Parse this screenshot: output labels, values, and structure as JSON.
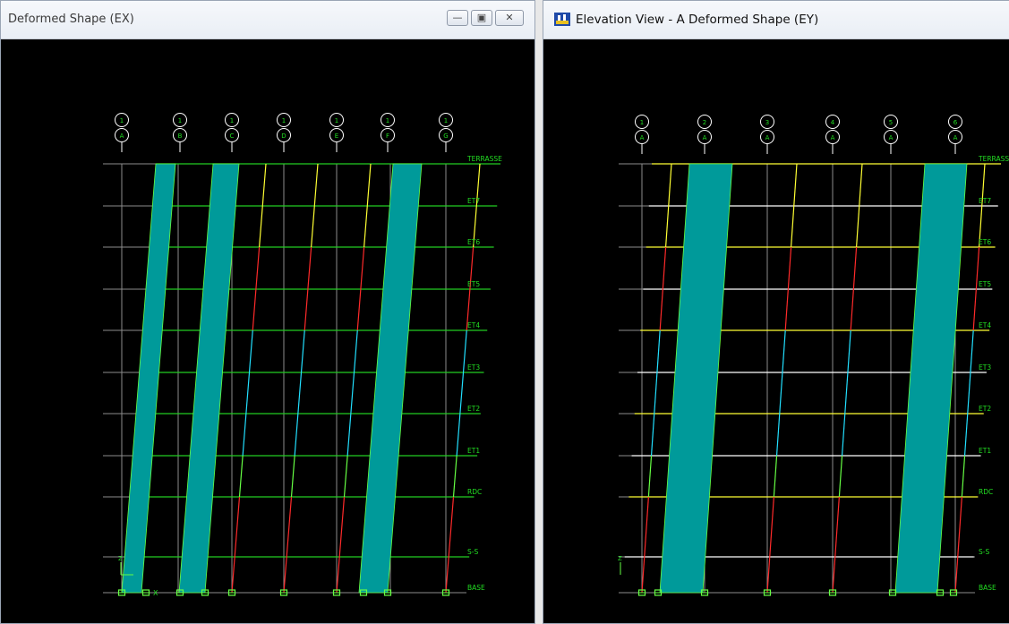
{
  "left_window": {
    "title": "Deformed Shape (EX)",
    "buttons": {
      "minimize": "—",
      "restore": "▣",
      "close": "✕"
    },
    "grid_bubbles": [
      {
        "top": "1",
        "bottom": "A"
      },
      {
        "top": "1",
        "bottom": "B"
      },
      {
        "top": "1",
        "bottom": "C"
      },
      {
        "top": "1",
        "bottom": "D"
      },
      {
        "top": "1",
        "bottom": "E"
      },
      {
        "top": "1",
        "bottom": "F"
      },
      {
        "top": "1",
        "bottom": "G"
      }
    ],
    "story_labels": [
      "TERRASSE",
      "ET7",
      "ET6",
      "ET5",
      "ET4",
      "ET3",
      "ET2",
      "ET1",
      "RDC",
      "S-S",
      "BASE"
    ],
    "axis_labels": {
      "z": "Z",
      "x": "X"
    }
  },
  "right_window": {
    "title": "Elevation View - A  Deformed Shape (EY)",
    "grid_bubbles": [
      {
        "top": "1",
        "bottom": "A"
      },
      {
        "top": "2",
        "bottom": "A"
      },
      {
        "top": "3",
        "bottom": "A"
      },
      {
        "top": "4",
        "bottom": "A"
      },
      {
        "top": "5",
        "bottom": "A"
      },
      {
        "top": "6",
        "bottom": "A"
      }
    ],
    "story_labels": [
      "TERRASSE",
      "ET7",
      "ET6",
      "ET5",
      "ET4",
      "ET3",
      "ET2",
      "ET1",
      "RDC",
      "S-S",
      "BASE"
    ],
    "axis_labels": {
      "z": "Z"
    }
  },
  "colors": {
    "background": "#000000",
    "wall": "#009a9a",
    "grid": "#8c8c8c",
    "beam_green": "#22cc22",
    "beam_yellow": "#ffff33",
    "beam_white": "#ffffff",
    "col_red": "#ff2a2a",
    "col_cyan": "#22e0ff",
    "col_green": "#66ff44",
    "col_yellow": "#ffff33",
    "label": "#22dd22"
  }
}
